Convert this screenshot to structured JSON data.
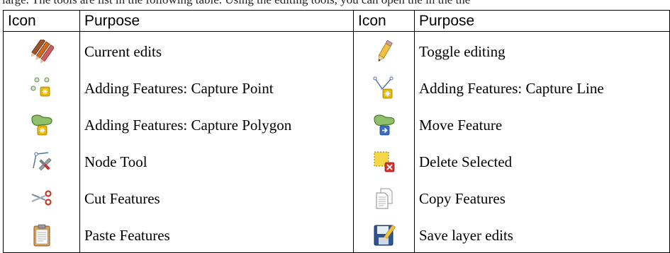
{
  "top_fragment": "large. The tools are list in the following table. Using the editing tools, you can open the in the the",
  "table": {
    "headers": [
      "Icon",
      "Purpose",
      "Icon",
      "Purpose"
    ],
    "rows": [
      {
        "left": {
          "icon": "current-edits-icon",
          "label": "Current edits"
        },
        "right": {
          "icon": "toggle-editing-icon",
          "label": "Toggle editing"
        }
      },
      {
        "left": {
          "icon": "capture-point-icon",
          "label": "Adding Features: Capture Point"
        },
        "right": {
          "icon": "capture-line-icon",
          "label": "Adding Features: Capture Line"
        }
      },
      {
        "left": {
          "icon": "capture-polygon-icon",
          "label": "Adding Features: Capture Polygon"
        },
        "right": {
          "icon": "move-feature-icon",
          "label": "Move Feature"
        }
      },
      {
        "left": {
          "icon": "node-tool-icon",
          "label": "Node Tool"
        },
        "right": {
          "icon": "delete-selected-icon",
          "label": "Delete Selected"
        }
      },
      {
        "left": {
          "icon": "cut-features-icon",
          "label": "Cut Features"
        },
        "right": {
          "icon": "copy-features-icon",
          "label": "Copy Features"
        }
      },
      {
        "left": {
          "icon": "paste-features-icon",
          "label": "Paste Features"
        },
        "right": {
          "icon": "save-layer-edits-icon",
          "label": "Save layer edits"
        }
      }
    ]
  }
}
